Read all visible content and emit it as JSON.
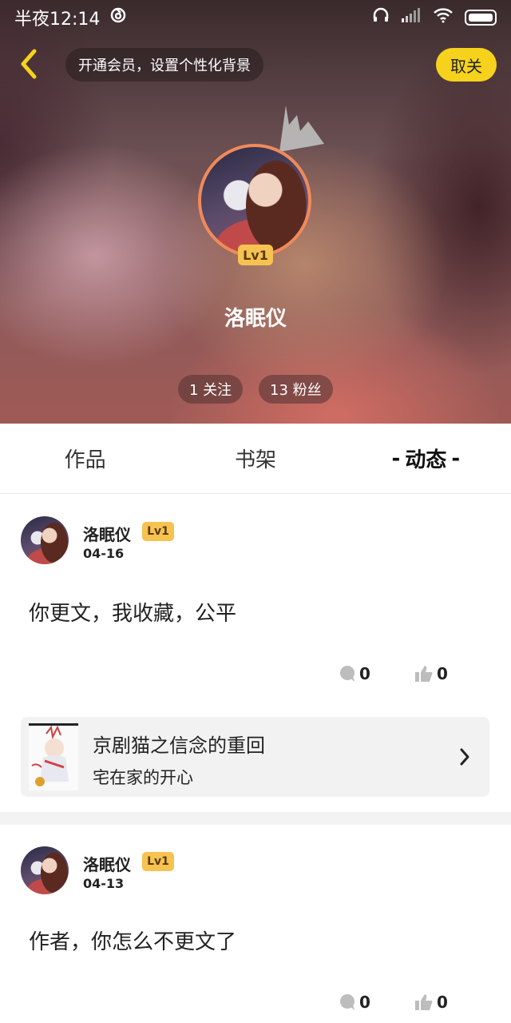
{
  "status_bar": {
    "time": "半夜12:14"
  },
  "header": {
    "promo_text": "开通会员，设置个性化背景",
    "unfollow_label": "取关",
    "level": "Lv1",
    "username": "洛眠仪",
    "follow_count": "1 关注",
    "fans_count": "13 粉丝"
  },
  "tabs": [
    {
      "label": "作品"
    },
    {
      "label": "书架"
    },
    {
      "label": "动态",
      "dash_left": "-",
      "dash_right": "-"
    }
  ],
  "posts": [
    {
      "author": "洛眠仪",
      "level": "Lv1",
      "date": "04-16",
      "content": "你更文，我收藏，公平",
      "comments": "0",
      "likes": "0",
      "book": {
        "title": "京剧猫之信念的重回",
        "author": "宅在家的开心"
      }
    },
    {
      "author": "洛眠仪",
      "level": "Lv1",
      "date": "04-13",
      "content": "作者，你怎么不更文了",
      "comments": "0",
      "likes": "0"
    }
  ],
  "colors": {
    "accent_yellow": "#f7d21c",
    "level_badge": "#f6c251",
    "avatar_ring": "#f08a5a"
  }
}
